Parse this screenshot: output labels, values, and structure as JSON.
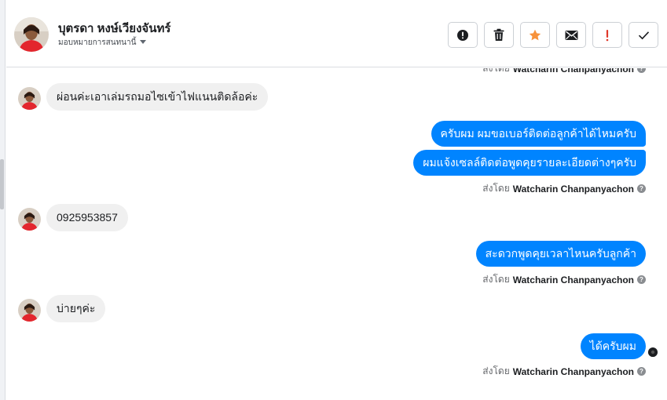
{
  "contact": {
    "name": "บุตรดา หงษ์เวียงจันทร์",
    "assign_label": "มอบหมายการสนทนานี้"
  },
  "toolbar": [
    {
      "name": "alert-circle-button",
      "icon": "alert-circle-icon"
    },
    {
      "name": "delete-button",
      "icon": "trash-icon"
    },
    {
      "name": "star-button",
      "icon": "star-icon"
    },
    {
      "name": "mark-unread-button",
      "icon": "envelope-icon"
    },
    {
      "name": "flag-button",
      "icon": "exclamation-icon"
    },
    {
      "name": "mark-done-button",
      "icon": "check-icon"
    }
  ],
  "colors": {
    "accent": "#0084ff",
    "incoming_bubble": "#f0f0f0",
    "star": "#f7923b",
    "flag": "#e0392b"
  },
  "sent_by_prefix": "ส่งโดย",
  "agent_name": "Watcharin Chanpanyachon",
  "messages": [
    {
      "dir": "in",
      "text": "ผ่อนค่ะเอาเล่มรถมอไซเข้าไฟแนนติดล้อค่ะ"
    },
    {
      "dir": "out",
      "text": "ครับผม ผมขอเบอร์ติดต่อลูกค้าได้ไหมครับ"
    },
    {
      "dir": "out",
      "text": "ผมแจ้งเซลล์ติดต่อพูดคุยรายละเอียดต่างๆครับ"
    },
    {
      "dir": "in",
      "text": "0925953857"
    },
    {
      "dir": "out",
      "text": "สะดวกพูดคุยเวลาไหนครับลูกค้า"
    },
    {
      "dir": "in",
      "text": "บ่ายๆค่ะ"
    },
    {
      "dir": "out",
      "text": "ได้ครับผม"
    }
  ]
}
